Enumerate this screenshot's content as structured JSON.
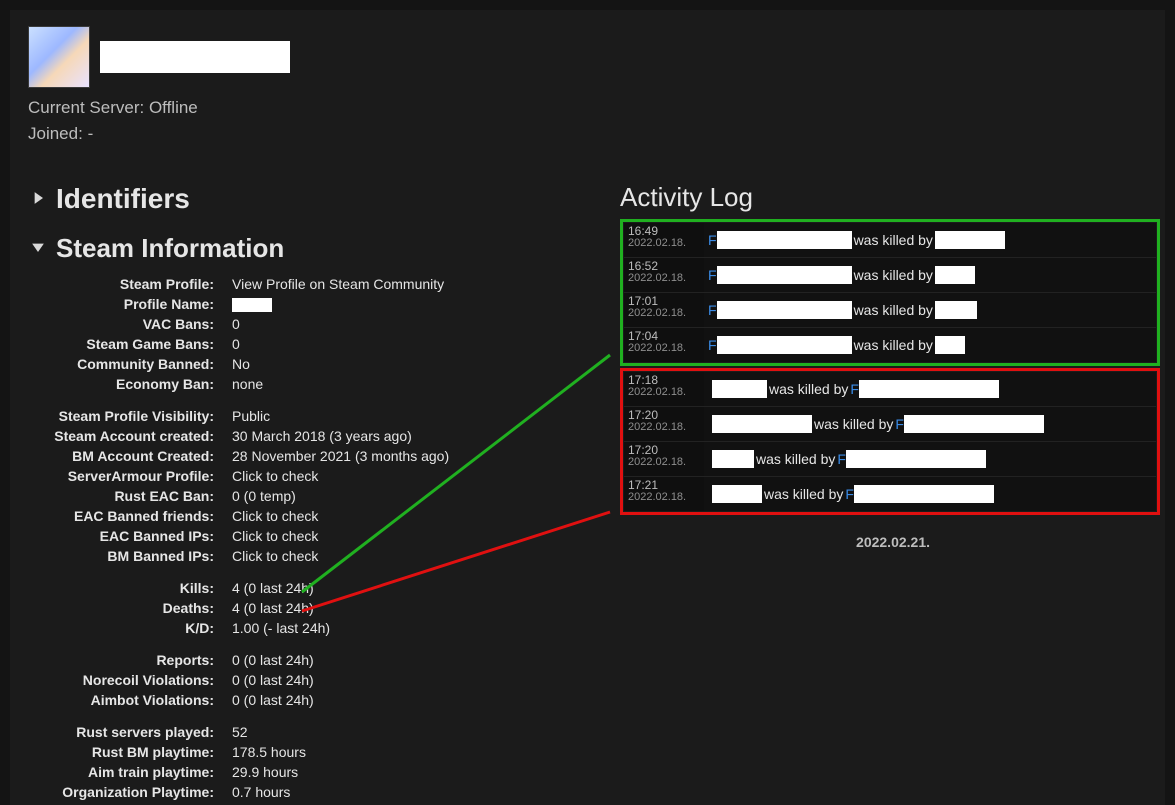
{
  "header": {
    "current_server_label": "Current Server:",
    "current_server_value": "Offline",
    "joined_label": "Joined:",
    "joined_value": "-"
  },
  "identifiers_title": "Identifiers",
  "steam_info_title": "Steam Information",
  "steam": {
    "profile_label": "Steam Profile:",
    "profile_link": "View Profile on Steam Community",
    "profile_name_label": "Profile Name:",
    "vac_bans_label": "VAC Bans:",
    "vac_bans_value": "0",
    "game_bans_label": "Steam Game Bans:",
    "game_bans_value": "0",
    "community_banned_label": "Community Banned:",
    "community_banned_value": "No",
    "economy_ban_label": "Economy Ban:",
    "economy_ban_value": "none",
    "visibility_label": "Steam Profile Visibility:",
    "visibility_value": "Public",
    "steam_created_label": "Steam Account created:",
    "steam_created_value": "30 March 2018 (3 years ago)",
    "bm_created_label": "BM Account Created:",
    "bm_created_value": "28 November 2021 (3 months ago)",
    "sa_profile_label": "ServerArmour Profile:",
    "click_to_check": "Click to check",
    "rust_eac_label": "Rust EAC Ban:",
    "rust_eac_value": "0 (0 temp)",
    "eac_friends_label": "EAC Banned friends:",
    "eac_ips_label": "EAC Banned IPs:",
    "bm_ips_label": "BM Banned IPs:",
    "kills_label": "Kills:",
    "kills_value": "4 (0 last 24h)",
    "deaths_label": "Deaths:",
    "deaths_value": "4 (0 last 24h)",
    "kd_label": "K/D:",
    "kd_value": "1.00 (- last 24h)",
    "reports_label": "Reports:",
    "reports_value": "0 (0 last 24h)",
    "norecoil_label": "Norecoil Violations:",
    "norecoil_value": "0 (0 last 24h)",
    "aimbot_label": "Aimbot Violations:",
    "aimbot_value": "0 (0 last 24h)",
    "servers_played_label": "Rust servers played:",
    "servers_played_value": "52",
    "bm_play_label": "Rust BM playtime:",
    "bm_play_value": "178.5 hours",
    "aim_play_label": "Aim train playtime:",
    "aim_play_value": "29.9 hours",
    "org_play_label": "Organization Playtime:",
    "org_play_value": "0.7 hours"
  },
  "activity": {
    "title": "Activity Log",
    "was_killed_by": " was killed by ",
    "prefix_letter": "F",
    "green": [
      {
        "time": "16:49",
        "date": "2022.02.18."
      },
      {
        "time": "16:52",
        "date": "2022.02.18."
      },
      {
        "time": "17:01",
        "date": "2022.02.18."
      },
      {
        "time": "17:04",
        "date": "2022.02.18."
      }
    ],
    "red": [
      {
        "time": "17:18",
        "date": "2022.02.18."
      },
      {
        "time": "17:20",
        "date": "2022.02.18."
      },
      {
        "time": "17:20",
        "date": "2022.02.18."
      },
      {
        "time": "17:21",
        "date": "2022.02.18."
      }
    ],
    "next_date": "2022.02.21."
  }
}
